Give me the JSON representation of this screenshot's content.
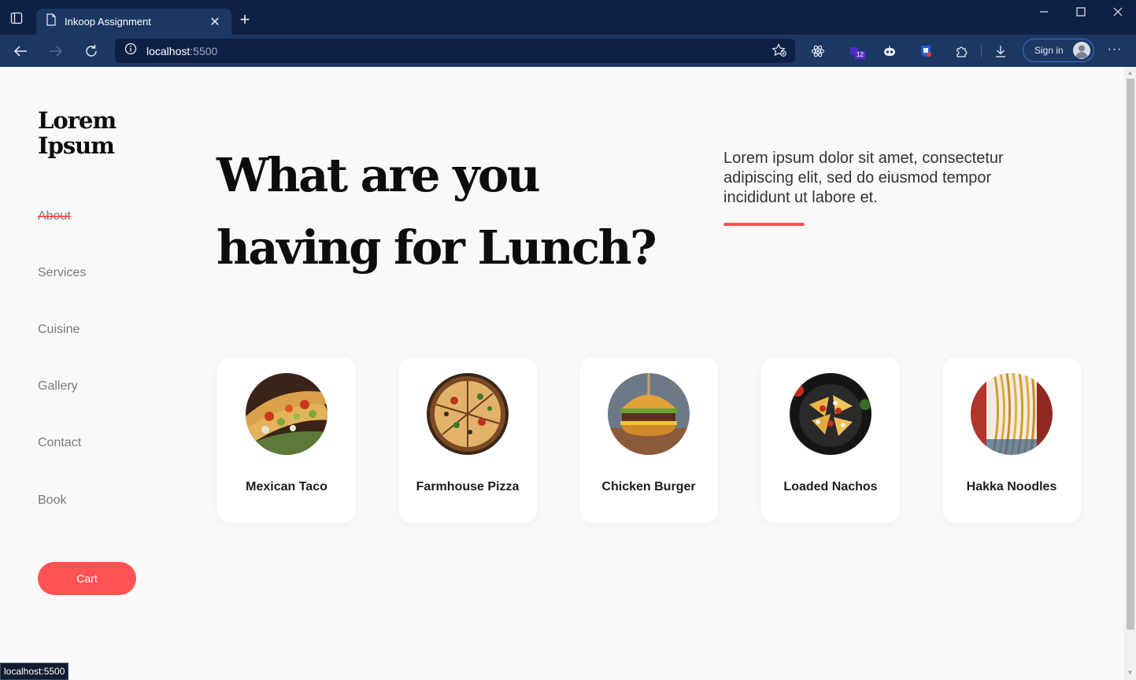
{
  "browser": {
    "tab_title": "Inkoop Assignment",
    "url_host": "localhost",
    "url_port": ":5500",
    "sign_in_label": "Sign in",
    "extension_badge": "12",
    "status_url": "localhost:5500"
  },
  "site": {
    "logo_line1": "Lorem",
    "logo_line2": "Ipsum",
    "nav": [
      "About",
      "Services",
      "Cuisine",
      "Gallery",
      "Contact",
      "Book"
    ],
    "cart_label": "Cart",
    "headline_line1": "What are you",
    "headline_line2": "having for Lunch?",
    "lede": "Lorem ipsum dolor sit amet, consectetur adipiscing elit, sed do eiusmod tempor incididunt ut labore et.",
    "accent_color": "#ff5252",
    "dishes": [
      {
        "name": "Mexican Taco",
        "icon": "taco-image"
      },
      {
        "name": "Farmhouse Pizza",
        "icon": "pizza-image"
      },
      {
        "name": "Chicken Burger",
        "icon": "burger-image"
      },
      {
        "name": "Loaded Nachos",
        "icon": "nachos-image"
      },
      {
        "name": "Hakka Noodles",
        "icon": "noodles-image"
      }
    ]
  }
}
